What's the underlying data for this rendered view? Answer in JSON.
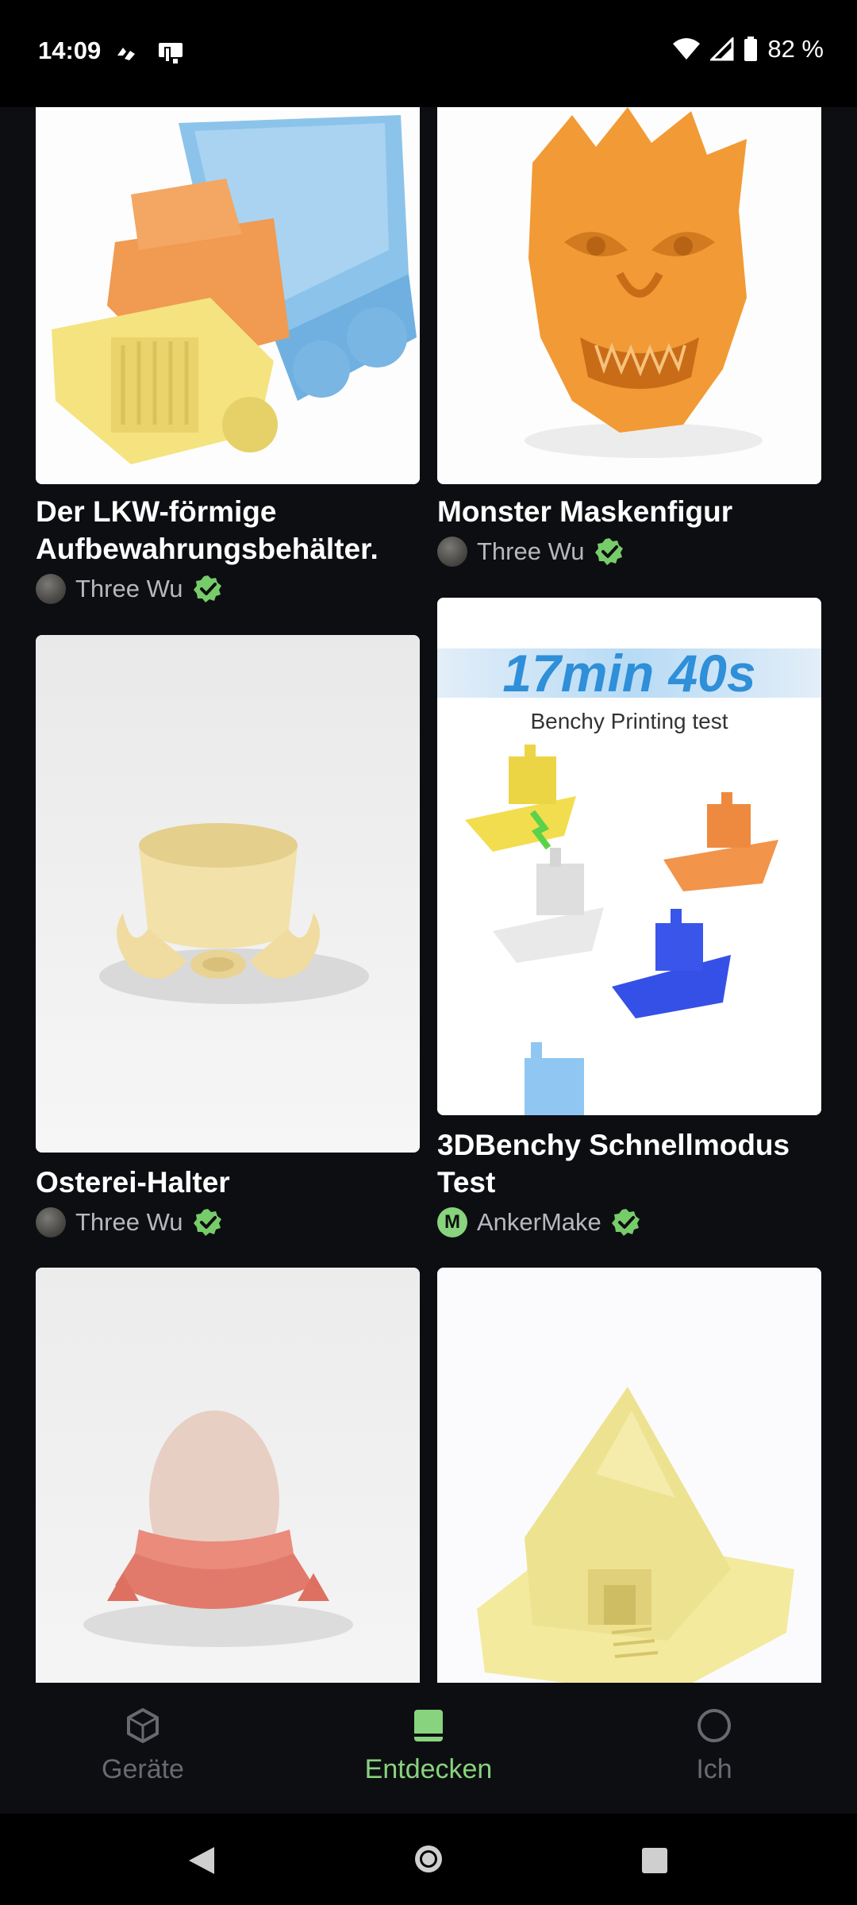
{
  "status": {
    "time": "14:09",
    "battery": "82 %"
  },
  "cards": [
    {
      "title": "Der LKW-förmige Aufbewahrungsbehälter.",
      "author": "Three Wu",
      "image": "truck-storage-box"
    },
    {
      "title": "Monster Maskenfigur",
      "author": "Three Wu",
      "image": "monster-mask"
    },
    {
      "title": "Osterei-Halter",
      "author": "Three Wu",
      "image": "octopus-egg-holder"
    },
    {
      "title": "3DBenchy Schnellmodus Test",
      "author": "AnkerMake",
      "image": "benchy-boats",
      "image_text": {
        "headline": "17min 40s",
        "sub": "Benchy Printing test"
      }
    },
    {
      "title": "",
      "author": "",
      "image": "egg-cup-bird"
    },
    {
      "title": "",
      "author": "",
      "image": "house-model"
    }
  ],
  "nav": {
    "items": [
      {
        "label": "Geräte",
        "icon": "cube-icon"
      },
      {
        "label": "Entdecken",
        "icon": "book-icon",
        "active": true
      },
      {
        "label": "Ich",
        "icon": "profile-circle-icon"
      }
    ],
    "active_color": "#88d37d"
  },
  "system_nav": [
    "back",
    "home",
    "recents"
  ]
}
